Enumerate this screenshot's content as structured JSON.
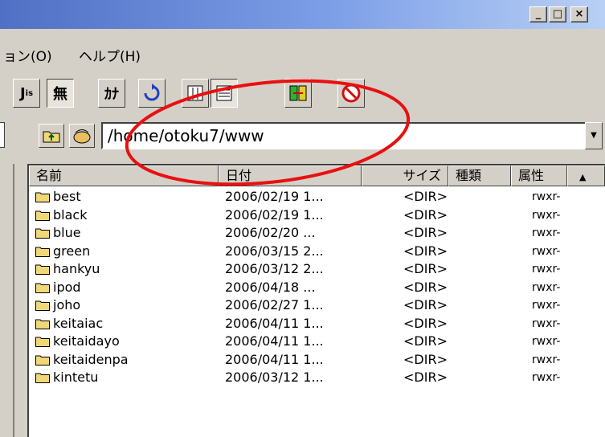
{
  "window": {
    "minimize_glyph": "_",
    "maximize_glyph": "□",
    "close_glyph": "×"
  },
  "menu": {
    "items": [
      "ョン(O)",
      "ヘルプ(H)"
    ]
  },
  "toolbar": {
    "buttons": [
      "J",
      "無",
      "ｶﾅ",
      "refresh-icon",
      "list-view-icon",
      "detail-view-icon",
      "sync-icon",
      "stop-icon"
    ]
  },
  "address": {
    "path": "/home/otoku7/www"
  },
  "columns": {
    "name": "名前",
    "date": "日付",
    "size": "サイズ",
    "type": "種類",
    "attr": "属性"
  },
  "rows": [
    {
      "name": "best",
      "date": "2006/02/19 1...",
      "size": "<DIR>",
      "attr": "rwxr-"
    },
    {
      "name": "black",
      "date": "2006/02/19 1...",
      "size": "<DIR>",
      "attr": "rwxr-"
    },
    {
      "name": "blue",
      "date": "2006/02/20  ...",
      "size": "<DIR>",
      "attr": "rwxr-"
    },
    {
      "name": "green",
      "date": "2006/03/15 2...",
      "size": "<DIR>",
      "attr": "rwxr-"
    },
    {
      "name": "hankyu",
      "date": "2006/03/12 2...",
      "size": "<DIR>",
      "attr": "rwxr-"
    },
    {
      "name": "ipod",
      "date": "2006/04/18  ...",
      "size": "<DIR>",
      "attr": "rwxr-"
    },
    {
      "name": "joho",
      "date": "2006/02/27 1...",
      "size": "<DIR>",
      "attr": "rwxr-"
    },
    {
      "name": "keitaiac",
      "date": "2006/04/11 1...",
      "size": "<DIR>",
      "attr": "rwxr-"
    },
    {
      "name": "keitaidayo",
      "date": "2006/04/11 1...",
      "size": "<DIR>",
      "attr": "rwxr-"
    },
    {
      "name": "keitaidenpa",
      "date": "2006/04/11 1...",
      "size": "<DIR>",
      "attr": "rwxr-"
    },
    {
      "name": "kintetu",
      "date": "2006/03/12 1...",
      "size": "<DIR>",
      "attr": "rwxr-"
    }
  ],
  "colors": {
    "annotation": "#e81010",
    "folder": "#f0d878",
    "titlebar": "#6a8cd8"
  }
}
